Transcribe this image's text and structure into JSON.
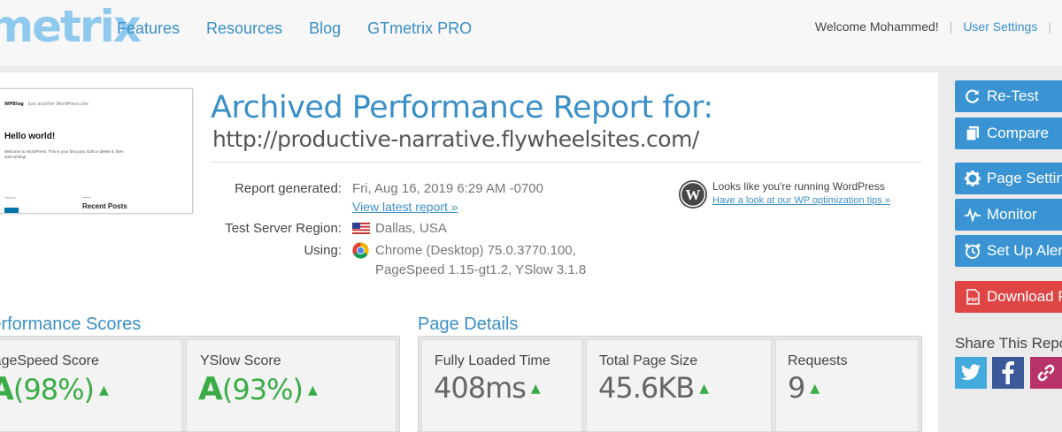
{
  "header": {
    "logo": "metrix",
    "nav": [
      "Features",
      "Resources",
      "Blog",
      "GTmetrix PRO"
    ],
    "welcome": "Welcome Mohammed!",
    "user_settings": "User Settings"
  },
  "thumbnail": {
    "site_name": "WPBlog",
    "tagline": "Just another WordPress site",
    "post_title": "Hello world!",
    "post_body": "Welcome to WordPress. This is your first post. Edit or delete it, then start writing!",
    "search_label": "Search",
    "recent_posts": "Recent Posts"
  },
  "report": {
    "title": "Archived Performance Report for:",
    "url": "http://productive-narrative.flywheelsites.com/",
    "generated_label": "Report generated:",
    "generated_value": "Fri, Aug 16, 2019 6:29 AM -0700",
    "view_latest": "View latest report »",
    "region_label": "Test Server Region:",
    "region_value": "Dallas, USA",
    "using_label": "Using:",
    "using_value_1": "Chrome (Desktop) 75.0.3770.100,",
    "using_value_2": "PageSpeed 1.15-gt1.2, YSlow 3.1.8"
  },
  "wordpress_notice": {
    "text": "Looks like you're running WordPress",
    "link": "Have a look at our WP optimization tips »"
  },
  "performance": {
    "title": "Performance Scores",
    "pagespeed_label": "PageSpeed Score",
    "pagespeed_grade": "A",
    "pagespeed_pct": "(98%)",
    "yslow_label": "YSlow Score",
    "yslow_grade": "A",
    "yslow_pct": "(93%)"
  },
  "page_details": {
    "title": "Page Details",
    "loaded_label": "Fully Loaded Time",
    "loaded_value": "408ms",
    "size_label": "Total Page Size",
    "size_value": "45.6KB",
    "requests_label": "Requests",
    "requests_value": "9"
  },
  "sidebar": {
    "buttons": [
      "Re-Test",
      "Compare",
      "Page Settings",
      "Monitor",
      "Set Up Alerts",
      "Download PDF"
    ],
    "share_title": "Share This Report"
  },
  "colors": {
    "brand_blue": "#3a8fc7",
    "button_blue": "#3a94d4",
    "download_red": "#e04545",
    "grade_green": "#3aac46"
  }
}
